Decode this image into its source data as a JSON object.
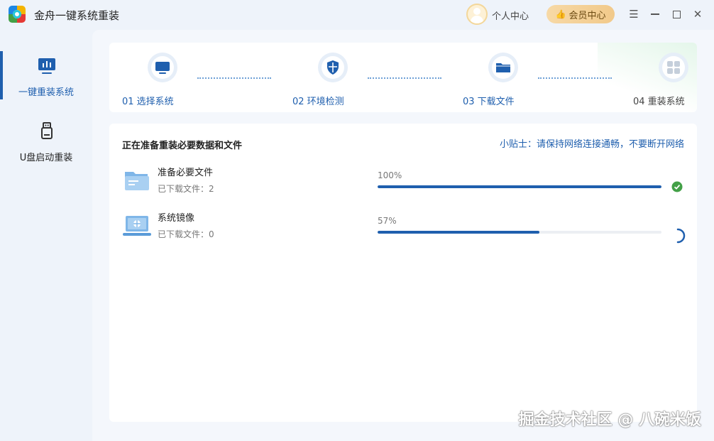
{
  "app": {
    "title": "金舟一键系统重装",
    "personal_center": "个人中心",
    "vip_center": "会员中心",
    "accent_color": "#1f5fae"
  },
  "sidebar": {
    "items": [
      {
        "label": "一键重装系统",
        "icon": "monitor-chart-icon",
        "active": true
      },
      {
        "label": "U盘启动重装",
        "icon": "usb-drive-icon",
        "active": false
      }
    ]
  },
  "steps": [
    {
      "label": "01 选择系统",
      "icon": "monitor-icon",
      "state": "done"
    },
    {
      "label": "02 环境检测",
      "icon": "shield-icon",
      "state": "done"
    },
    {
      "label": "03 下载文件",
      "icon": "folder-icon",
      "state": "current"
    },
    {
      "label": "04 重装系统",
      "icon": "windows-grid-icon",
      "state": "pending"
    }
  ],
  "download": {
    "title": "正在准备重装必要数据和文件",
    "tip": "小贴士：请保持网络连接通畅，不要断开网络",
    "tasks": [
      {
        "name": "准备必要文件",
        "sub": "已下载文件：2",
        "percent_text": "100%",
        "progress": 1.0,
        "status": "complete"
      },
      {
        "name": "系统镜像",
        "sub": "已下载文件：0",
        "percent_text": "57%",
        "progress": 0.57,
        "status": "loading"
      }
    ]
  },
  "watermark": "掘金技术社区 @ 八碗米饭"
}
